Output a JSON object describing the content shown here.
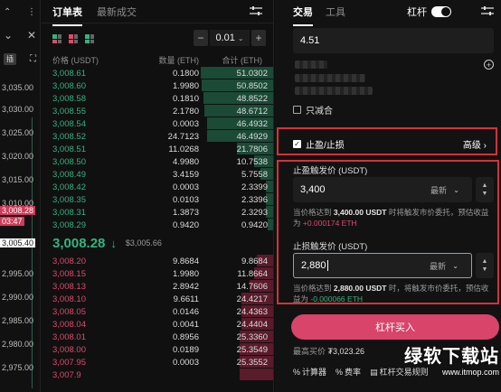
{
  "left": {
    "tag": "插",
    "ticks": [
      "3,035.00",
      "3,030.00",
      "3,025.00",
      "3,020.00",
      "3,015.00",
      "3,010.00",
      "3,005.40",
      "2,995.00",
      "2,990.00",
      "2,985.00",
      "2,980.00",
      "2,975.00"
    ],
    "price_hl": "3,008.28",
    "time_hl": "03:47"
  },
  "book": {
    "tabs": [
      "订单表",
      "最新成交"
    ],
    "step_value": "0.01",
    "headers": [
      "价格 (USDT)",
      "数量 (ETH)",
      "合计 (ETH)"
    ],
    "bids": [
      {
        "p": "3,008.61",
        "a": "0.1800",
        "t": "51.0302",
        "d": 1.0
      },
      {
        "p": "3,008.60",
        "a": "1.9980",
        "t": "50.8502",
        "d": 0.99
      },
      {
        "p": "3,008.58",
        "a": "0.1810",
        "t": "48.8522",
        "d": 0.96
      },
      {
        "p": "3,008.55",
        "a": "2.1780",
        "t": "48.6712",
        "d": 0.95
      },
      {
        "p": "3,008.54",
        "a": "0.0003",
        "t": "46.4932",
        "d": 0.91
      },
      {
        "p": "3,008.52",
        "a": "24.7123",
        "t": "46.4929",
        "d": 0.91
      },
      {
        "p": "3,008.51",
        "a": "11.0268",
        "t": "21.7806",
        "d": 0.5
      },
      {
        "p": "3,008.50",
        "a": "4.9980",
        "t": "10.7538",
        "d": 0.26
      },
      {
        "p": "3,008.49",
        "a": "3.4159",
        "t": "5.7558",
        "d": 0.17
      },
      {
        "p": "3,008.42",
        "a": "0.0003",
        "t": "2.3399",
        "d": 0.1
      },
      {
        "p": "3,008.35",
        "a": "0.0103",
        "t": "2.3396",
        "d": 0.1
      },
      {
        "p": "3,008.31",
        "a": "1.3873",
        "t": "2.3293",
        "d": 0.1
      },
      {
        "p": "3,008.29",
        "a": "0.9420",
        "t": "0.9420",
        "d": 0.08
      }
    ],
    "mid_price": "3,008.28",
    "mark_price": "$3,005.66",
    "asks": [
      {
        "p": "3,008.20",
        "a": "9.8684",
        "t": "9.8684",
        "d": 0.23
      },
      {
        "p": "3,008.15",
        "a": "1.9980",
        "t": "11.8664",
        "d": 0.26
      },
      {
        "p": "3,008.13",
        "a": "2.8942",
        "t": "14.7606",
        "d": 0.32
      },
      {
        "p": "3,008.10",
        "a": "9.6611",
        "t": "24.4217",
        "d": 0.44
      },
      {
        "p": "3,008.05",
        "a": "0.0146",
        "t": "24.4363",
        "d": 0.44
      },
      {
        "p": "3,008.04",
        "a": "0.0041",
        "t": "24.4404",
        "d": 0.44
      },
      {
        "p": "3,008.01",
        "a": "0.8956",
        "t": "25.3360",
        "d": 0.46
      },
      {
        "p": "3,008.00",
        "a": "0.0189",
        "t": "25.3549",
        "d": 0.46
      },
      {
        "p": "3,007.95",
        "a": "0.0003",
        "t": "25.3552",
        "d": 0.46
      },
      {
        "p": "3,007.9",
        "a": "",
        "t": "",
        "d": 0.46
      }
    ]
  },
  "panel": {
    "tabs": [
      "交易",
      "工具"
    ],
    "lever_label": "杠杆",
    "amount": "4.51",
    "reduce_only": "只减合",
    "tpsl_label": "止盈/止损",
    "advanced": "高级 ›",
    "tp_label": "止盈触发价 (USDT)",
    "tp_value": "3,400",
    "sl_label": "止损触发价 (USDT)",
    "sl_value": "2,880",
    "latest": "最新",
    "tp_hint_1": "当价格达到 ",
    "tp_hint_price": "3,400.00 USDT",
    "tp_hint_2": " 时将触发市价委托，预估收益为 ",
    "tp_hint_val": "+0.000174 ETH",
    "sl_hint_1": "当价格达到 ",
    "sl_hint_price": "2,880.00 USDT",
    "sl_hint_2": " 时，将触发市价委托，预估收益为 ",
    "sl_hint_val": "-0.000066 ETH",
    "buy_label": "杠杆买入",
    "max_buy_label": "最高买价 ",
    "max_buy_value": "₮3,023.26",
    "links": [
      "计算器",
      "费率",
      "杠杆交易规则"
    ]
  },
  "watermark": {
    "big": "绿软下载站",
    "small": "www.itmop.com"
  },
  "colors": {
    "bid": "#35b37e",
    "ask": "#e0496b",
    "accent": "#d8446a",
    "highlight_box": "#d3333a"
  }
}
